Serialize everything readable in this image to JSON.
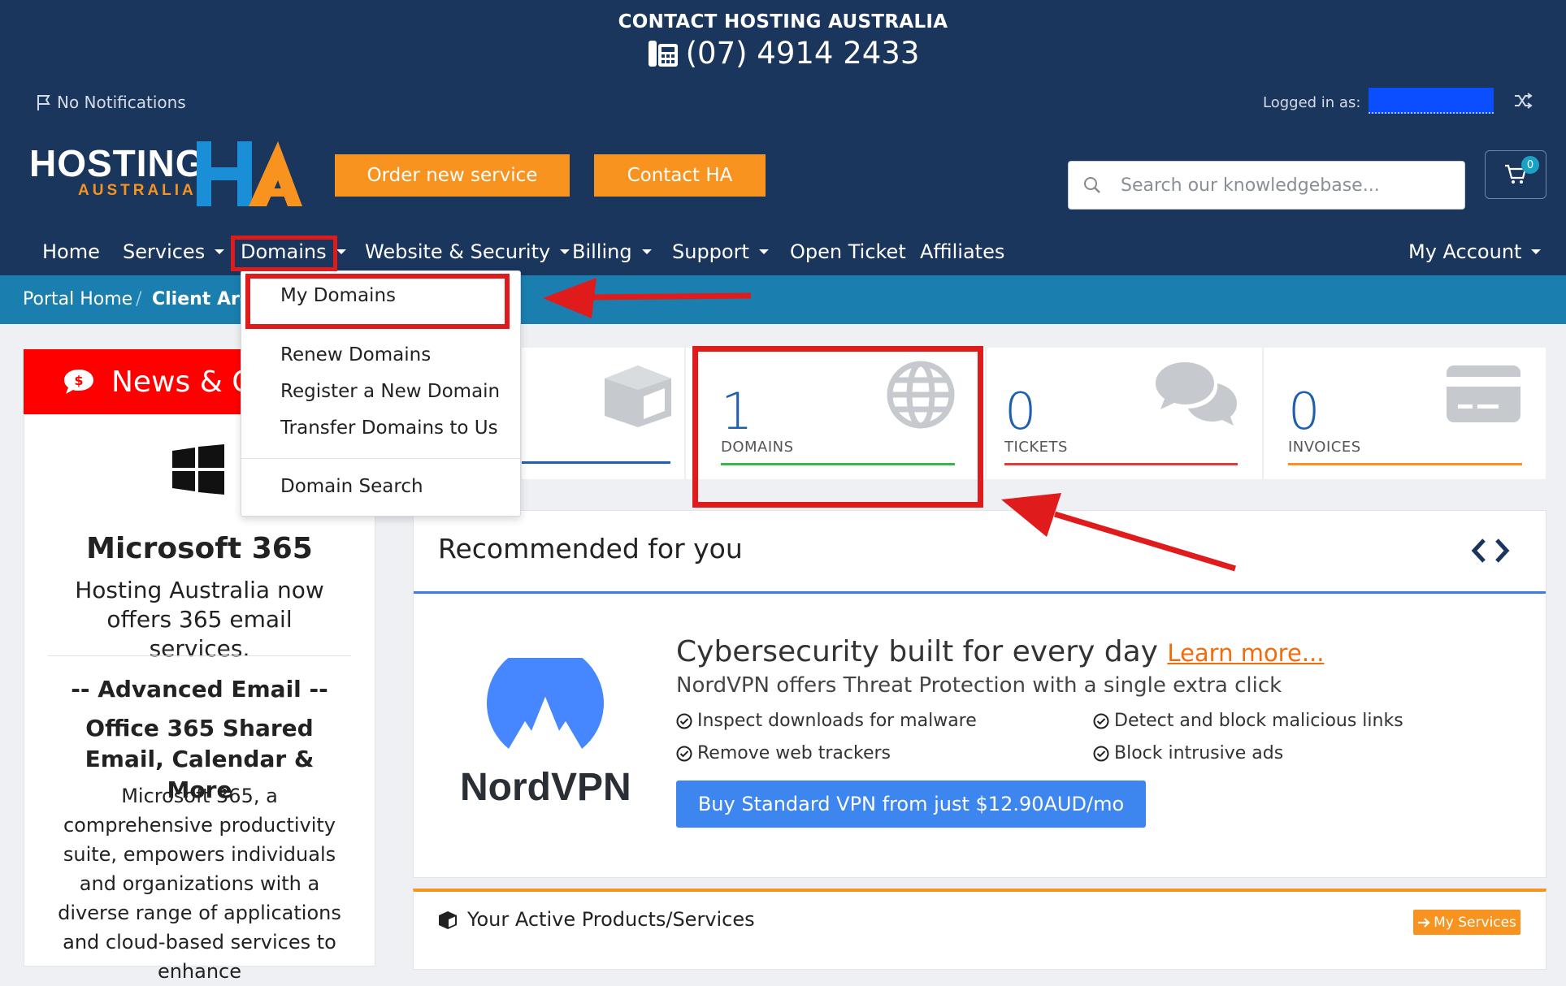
{
  "contact": {
    "title": "CONTACT HOSTING AUSTRALIA",
    "phone": "(07) 4914 2433"
  },
  "topbar": {
    "notifications": "No Notifications",
    "logged_in_label": "Logged in as:"
  },
  "logo": {
    "line1": "HOSTING",
    "line2": "AUSTRALIA"
  },
  "actions": {
    "order_new_service": "Order new service",
    "contact_ha": "Contact HA"
  },
  "search": {
    "placeholder": "Search our knowledgebase..."
  },
  "cart": {
    "count": "0"
  },
  "nav": {
    "home": "Home",
    "services": "Services",
    "domains": "Domains",
    "website_security": "Website & Security",
    "billing": "Billing",
    "support": "Support",
    "open_ticket": "Open Ticket",
    "affiliates": "Affiliates",
    "my_account": "My Account"
  },
  "breadcrumb": {
    "home": "Portal Home",
    "sep": "/",
    "current": "Client Area"
  },
  "domains_menu": {
    "my_domains": "My Domains",
    "renew": "Renew Domains",
    "register": "Register a New Domain",
    "transfer": "Transfer Domains to Us",
    "search": "Domain Search"
  },
  "news": {
    "heading": "News & O",
    "product": "Microsoft 365",
    "tagline": "Hosting Australia now offers 365 email services.",
    "adv": "-- Advanced Email --",
    "subhead": "Office 365 Shared Email, Calendar & More",
    "body": "Microsoft 365, a comprehensive productivity suite, empowers individuals and organizations with a diverse range of applications and cloud-based services to enhance"
  },
  "stats": {
    "domains": {
      "count": "1",
      "label": "DOMAINS"
    },
    "tickets": {
      "count": "0",
      "label": "TICKETS"
    },
    "invoices": {
      "count": "0",
      "label": "INVOICES"
    }
  },
  "recommended": {
    "title": "Recommended for you",
    "brand": "NordVPN",
    "headline": "Cybersecurity built for every day",
    "learn_more": "Learn more...",
    "subline": "NordVPN offers Threat Protection with a single extra click",
    "features": [
      "Inspect downloads for malware",
      "Detect and block malicious links",
      "Remove web trackers",
      "Block intrusive ads"
    ],
    "buy_button": "Buy Standard VPN from just $12.90AUD/mo"
  },
  "products": {
    "title": "Your Active Products/Services",
    "my_services": "My Services"
  },
  "colors": {
    "header": "#1b365d",
    "breadcrumb": "#1a7fae",
    "accent_orange": "#f7931e",
    "news_red": "#ff0000",
    "annotation_red": "#e01b1b"
  }
}
